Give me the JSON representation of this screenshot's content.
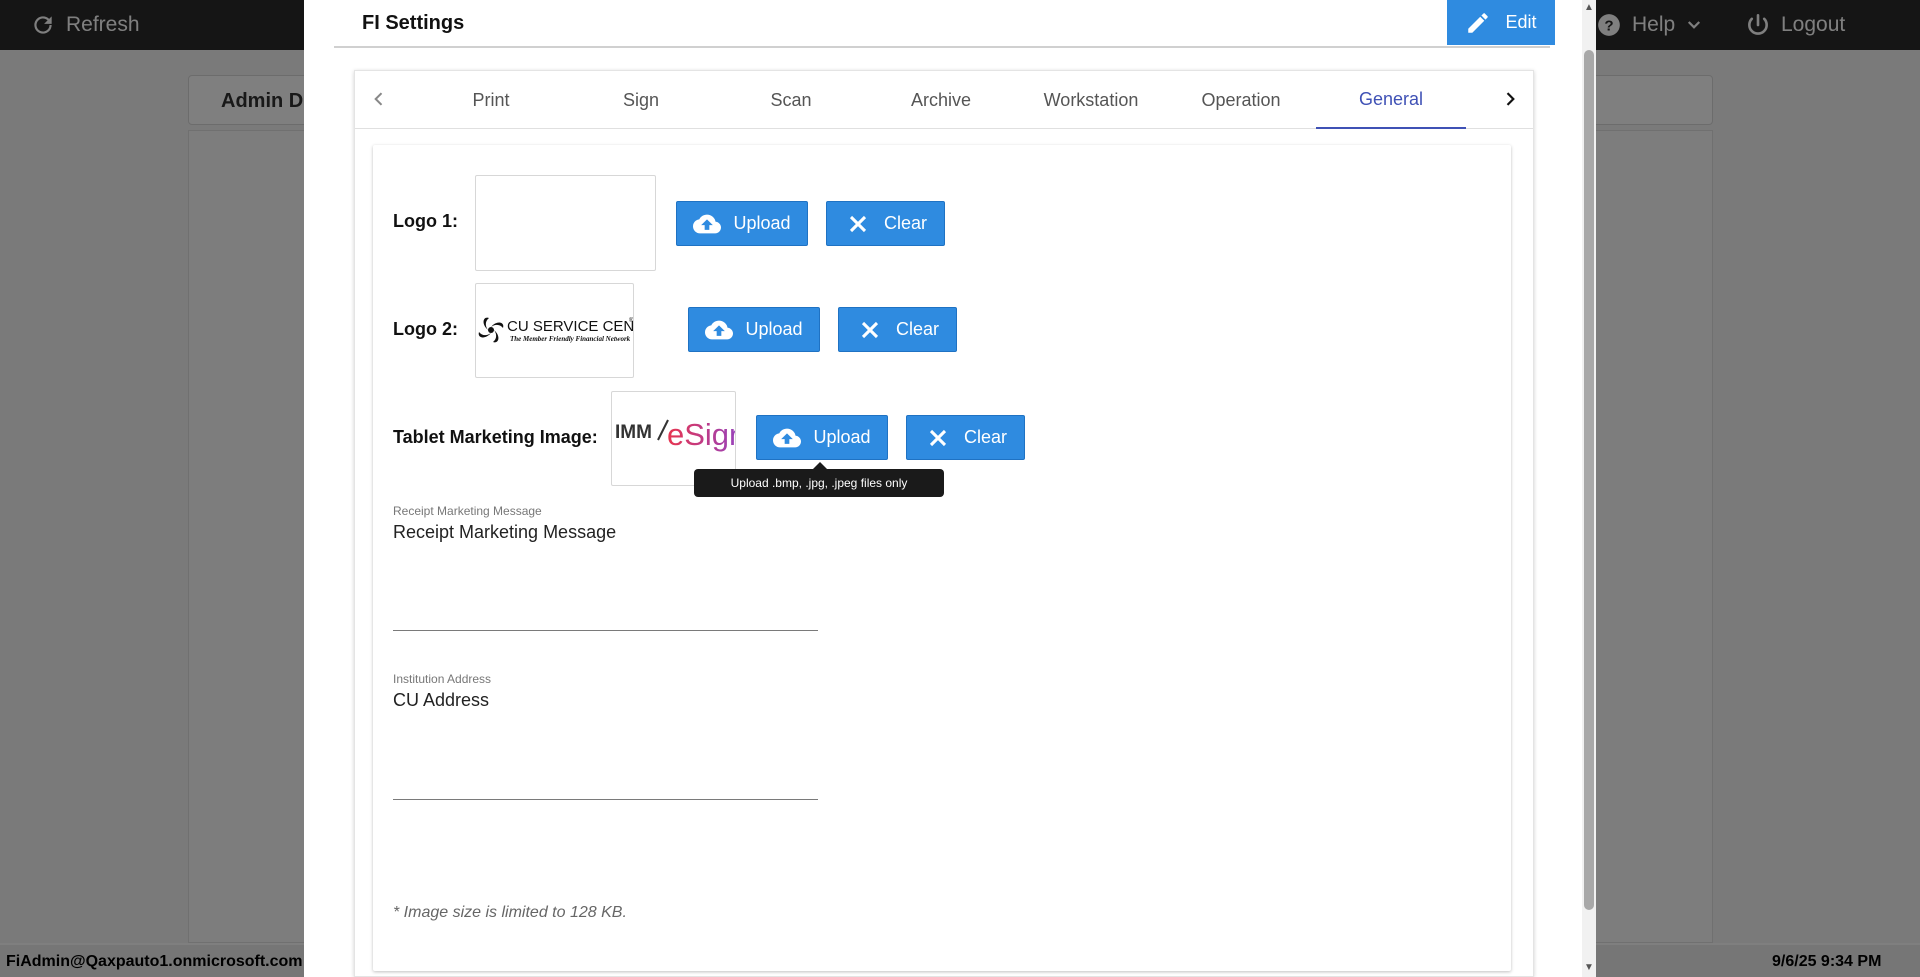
{
  "topbar": {
    "refresh_label": "Refresh",
    "help_label": "Help",
    "logout_label": "Logout"
  },
  "background": {
    "admin_tab_label": "Admin D",
    "status_user": "FiAdmin@Qaxpauto1.onmicrosoft.com",
    "status_time": "9/6/25 9:34 PM"
  },
  "dialog": {
    "title": "FI Settings",
    "edit_label": "Edit",
    "tabs": [
      {
        "label": "Print",
        "active": false
      },
      {
        "label": "Sign",
        "active": false
      },
      {
        "label": "Scan",
        "active": false
      },
      {
        "label": "Archive",
        "active": false
      },
      {
        "label": "Workstation",
        "active": false
      },
      {
        "label": "Operation",
        "active": false
      },
      {
        "label": "General",
        "active": true
      }
    ]
  },
  "general": {
    "logo1_label": "Logo 1:",
    "logo2_label": "Logo 2:",
    "tablet_label": "Tablet Marketing Image:",
    "upload_label": "Upload",
    "clear_label": "Clear",
    "tooltip": "Upload .bmp, .jpg, .jpeg files only",
    "logo2_image": {
      "brand": "CU SERVICE CENTERS",
      "tagline": "The Member Friendly Financial Network",
      "registered": "®"
    },
    "tablet_image": {
      "part1": "IMM",
      "part2": "eSign"
    },
    "receipt_message": {
      "label": "Receipt Marketing Message",
      "value": "Receipt Marketing Message"
    },
    "institution_address": {
      "label": "Institution Address",
      "value": "CU Address"
    },
    "note": "* Image size is limited to 128 KB."
  },
  "colors": {
    "primary_button": "#2f8be0",
    "active_tab": "#3f51b5",
    "topbar": "#2b2b2b"
  }
}
